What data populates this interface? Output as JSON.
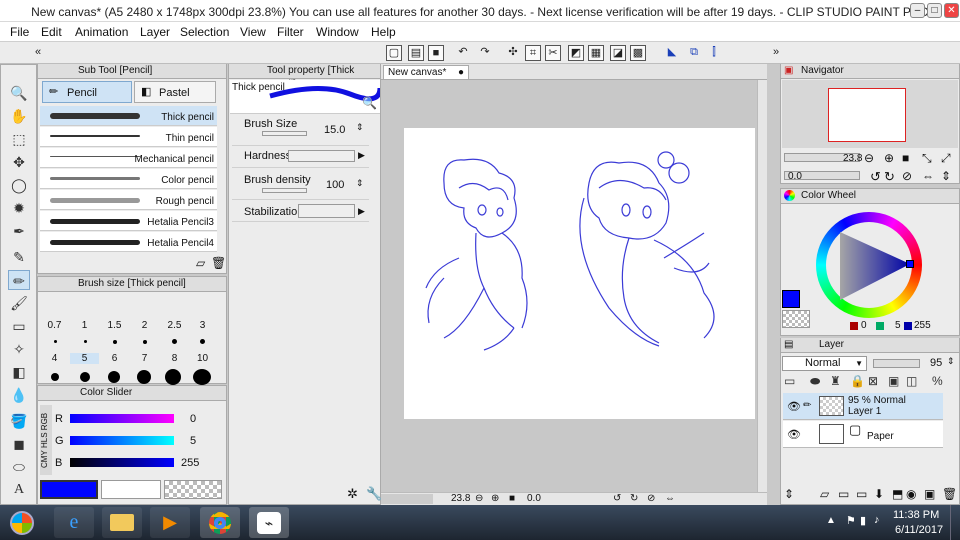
{
  "window": {
    "title": "New canvas* (A5 2480 x 1748px 300dpi 23.8%)  You can use all features for another 30 days. - Next license verification will be after 19 days. - CLIP STUDIO PAINT PRO",
    "min": "–",
    "max": "□",
    "close": "✕"
  },
  "menu": [
    "File",
    "Edit",
    "Animation",
    "Layer",
    "Selection",
    "View",
    "Filter",
    "Window",
    "Help"
  ],
  "subtool": {
    "header": "Sub Tool [Pencil]",
    "tabs": [
      "Pencil",
      "Pastel"
    ],
    "brushes": [
      "Thick pencil",
      "Thin pencil",
      "Mechanical pencil",
      "Color pencil",
      "Rough pencil",
      "Hetalia Pencil3",
      "Hetalia Pencil4"
    ]
  },
  "brushsize": {
    "header": "Brush size [Thick pencil]",
    "sizes": [
      "0.7",
      "1",
      "1.5",
      "2",
      "2.5",
      "3",
      "4",
      "5",
      "6",
      "7",
      "8",
      "10"
    ]
  },
  "colorslider": {
    "header": "Color Slider",
    "side_tabs": [
      "RGB",
      "HLS",
      "CMY"
    ],
    "r_label": "R",
    "r": "0",
    "g_label": "G",
    "g": "5",
    "b_label": "B",
    "b": "255",
    "main_color": "#0005ff"
  },
  "toolprop": {
    "header": "Tool property [Thick pencil]",
    "preview_label": "Thick pencil",
    "brush_size_label": "Brush Size",
    "brush_size": "15.0",
    "hardness_label": "Hardness",
    "density_label": "Brush density",
    "density": "100",
    "stabilization_label": "Stabilization"
  },
  "canvas": {
    "tab": "New canvas*",
    "zoom": "23.8",
    "rotation": "0.0"
  },
  "navigator": {
    "header": "Navigator",
    "zoom": "23.8",
    "rotation": "0.0"
  },
  "colorwheel": {
    "header": "Color Wheel",
    "h": "0",
    "s": "5",
    "v": "255"
  },
  "layer": {
    "header": "Layer",
    "blend": "Normal",
    "opacity": "95",
    "layers": [
      {
        "opacity_mode": "95 %  Normal",
        "name": "Layer 1"
      },
      {
        "name": "Paper"
      }
    ]
  },
  "taskbar": {
    "time": "11:38 PM",
    "date": "6/11/2017"
  }
}
